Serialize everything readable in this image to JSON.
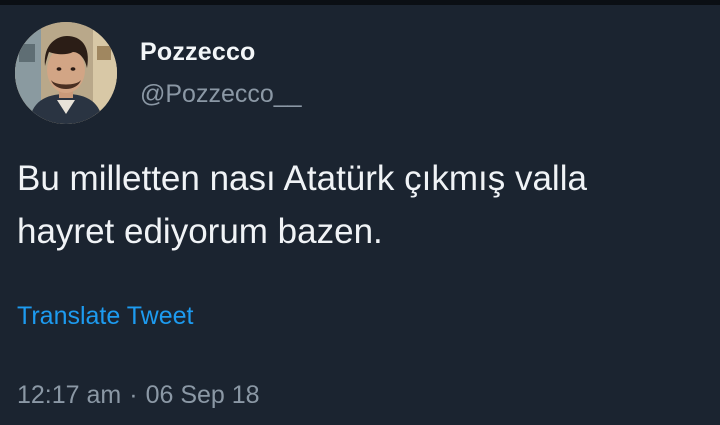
{
  "tweet": {
    "author": {
      "display_name": "Pozzecco",
      "handle": "@Pozzecco__",
      "avatar_icon": "profile-photo"
    },
    "text_line1": "Bu milletten nası Atatürk çıkmış valla",
    "text_line2": "hayret ediyorum bazen.",
    "translate_label": "Translate Tweet",
    "time": "12:17 am",
    "separator": "·",
    "date": "06 Sep 18"
  },
  "colors": {
    "background": "#1b2430",
    "link": "#1d9bf0",
    "secondary_text": "#8b98a5"
  }
}
